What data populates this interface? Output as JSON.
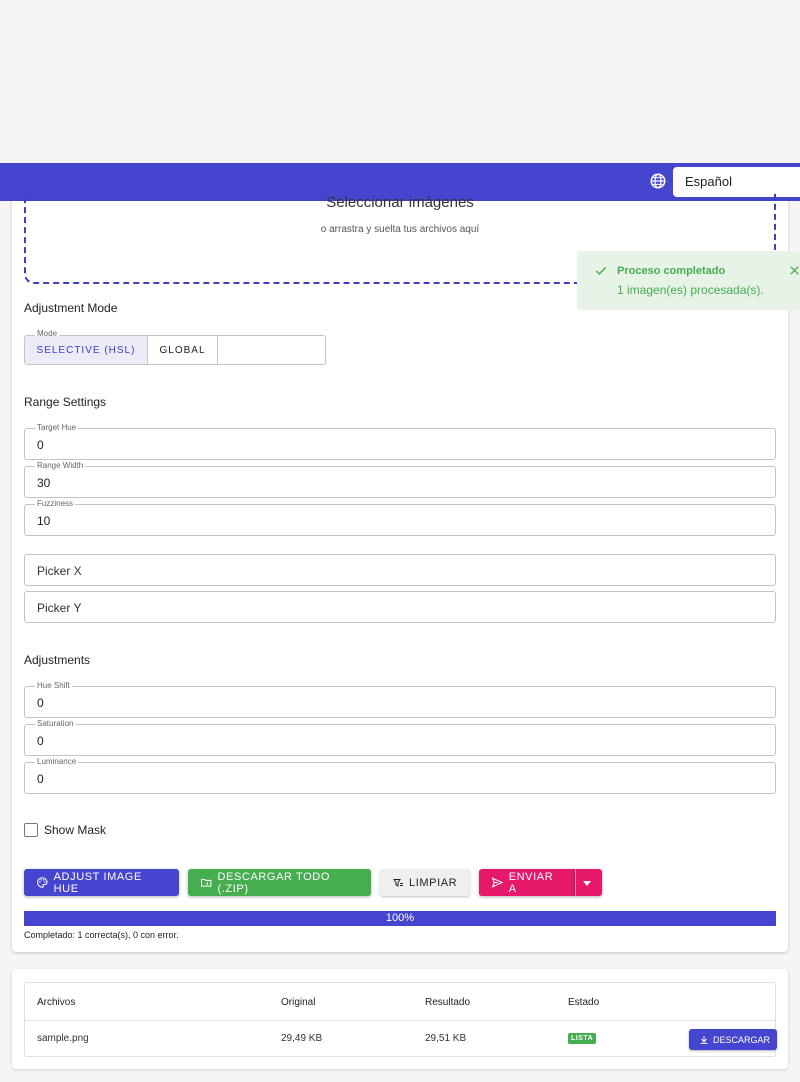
{
  "header": {
    "language_icon": "globe-icon",
    "language_value": "Español"
  },
  "dropzone": {
    "title": "Seleccionar imágenes",
    "subtitle": "o arrastra y suelta tus archivos aquí"
  },
  "adjustment_mode": {
    "section_label": "Adjustment Mode",
    "legend": "Mode",
    "options": [
      "SELECTIVE (HSL)",
      "GLOBAL"
    ],
    "selected": "SELECTIVE (HSL)"
  },
  "range_settings": {
    "section_label": "Range Settings",
    "target_hue": {
      "label": "Target Hue",
      "value": "0"
    },
    "range_width": {
      "label": "Range Width",
      "value": "30"
    },
    "fuzziness": {
      "label": "Fuzziness",
      "value": "10"
    },
    "picker_x": {
      "placeholder": "Picker X"
    },
    "picker_y": {
      "placeholder": "Picker Y"
    }
  },
  "adjustments": {
    "section_label": "Adjustments",
    "hue_shift": {
      "label": "Hue Shift",
      "value": "0"
    },
    "saturation": {
      "label": "Saturation",
      "value": "0"
    },
    "luminance": {
      "label": "Luminance",
      "value": "0"
    }
  },
  "show_mask": {
    "label": "Show Mask",
    "checked": false
  },
  "actions": {
    "adjust_label": "ADJUST IMAGE HUE",
    "zip_label": "DESCARGAR TODO (.ZIP)",
    "clear_label": "LIMPIAR",
    "send_label": "ENVIAR A"
  },
  "progress": {
    "percent": 100,
    "label": "100%",
    "status_text": "Completado: 1 correcta(s), 0 con error."
  },
  "results_table": {
    "headers": [
      "Archivos",
      "Original",
      "Resultado",
      "Estado"
    ],
    "rows": [
      {
        "file": "sample.png",
        "original": "29,49 KB",
        "result": "29,51 KB",
        "status": "LISTA",
        "action": "DESCARGAR"
      }
    ]
  },
  "toast": {
    "title": "Proceso completado",
    "message": "1 imagen(es) procesada(s)."
  },
  "colors": {
    "primary": "#4545d0",
    "success": "#46ad50",
    "accent": "#e6186a"
  }
}
